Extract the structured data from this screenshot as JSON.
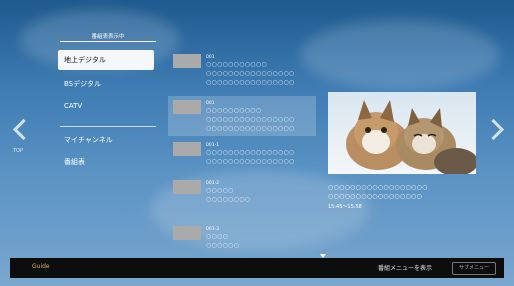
{
  "menu": {
    "title": "番組表表示中",
    "items": [
      "地上デジタル",
      "BSデジタル",
      "CATV",
      "マイチャンネル",
      "番組表"
    ],
    "selected_index": 0
  },
  "side": {
    "left_label": "TOP"
  },
  "list": {
    "rows": [
      {
        "channel": "001",
        "line1": "○○○○○○○○○○○",
        "line2": "○○○○○○○○○○○○○○○○",
        "line3": "○○○○○○○○○○○○○○○○",
        "active": false
      },
      {
        "channel": "001",
        "line1": "○○○○○○○○○○",
        "line2": "○○○○○○○○○○○○○○○○",
        "line3": "○○○○○○○○○○○○○○○○",
        "active": true
      },
      {
        "channel": "001-1",
        "line1": "○○○○",
        "line2": "○○○○○○○○○○○○○○○○",
        "line3": "○○○○○○○○○○○○○○○○",
        "active": false
      },
      {
        "channel": "001-2",
        "line1": "○○○○○",
        "line2": "○○○○○○○○",
        "line3": "",
        "active": false
      },
      {
        "channel": "001-3",
        "line1": "○○○○",
        "line2": "○○○○○○",
        "line3": "",
        "active": false
      }
    ]
  },
  "detail": {
    "lines": [
      "○○○○○○○○○○○○○○○○○○",
      "○○○○○○○○○○○○○○○○○"
    ],
    "time": "15:45～15:58"
  },
  "bottom": {
    "left_hint": "Guide",
    "right_hint": "番組メニューを表示",
    "sub_button": "サブメニュー"
  },
  "colors": {
    "selected_bg": "#f5f7fa",
    "bar": "#0d0d0d"
  }
}
